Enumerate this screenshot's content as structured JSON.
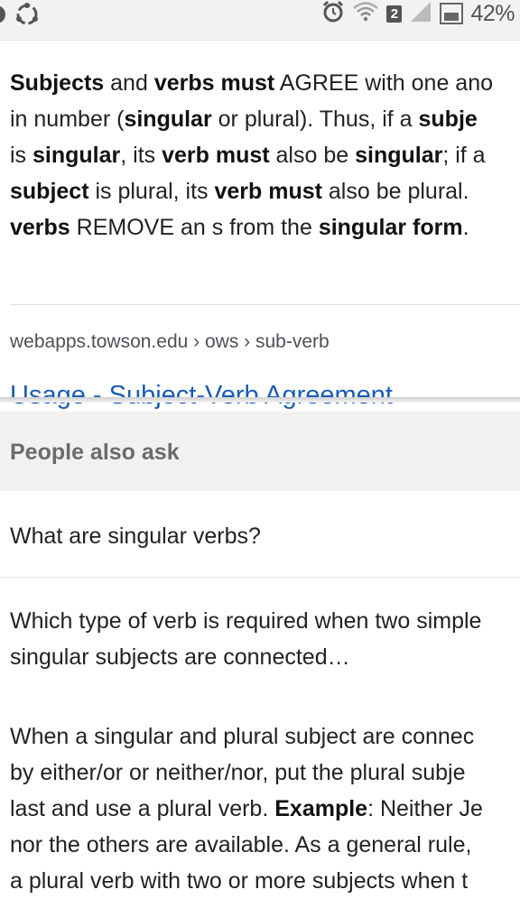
{
  "status_bar": {
    "notification_badge": "2",
    "battery_percent": "42%",
    "icons": [
      "notification-icon",
      "sync-icon",
      "alarm-icon",
      "wifi-icon",
      "signal-icon",
      "battery-icon"
    ]
  },
  "snippet": {
    "lines": [
      [
        {
          "t": "Subjects",
          "b": true
        },
        {
          "t": " and ",
          "b": false
        },
        {
          "t": "verbs must",
          "b": true
        },
        {
          "t": " AGREE with one ano",
          "b": false
        }
      ],
      [
        {
          "t": "in number (",
          "b": false
        },
        {
          "t": "singular",
          "b": true
        },
        {
          "t": " or plural). Thus, if a ",
          "b": false
        },
        {
          "t": "subje",
          "b": true
        }
      ],
      [
        {
          "t": "is ",
          "b": false
        },
        {
          "t": "singular",
          "b": true
        },
        {
          "t": ", its ",
          "b": false
        },
        {
          "t": "verb must",
          "b": true
        },
        {
          "t": " also be ",
          "b": false
        },
        {
          "t": "singular",
          "b": true
        },
        {
          "t": "; if a",
          "b": false
        }
      ],
      [
        {
          "t": "subject",
          "b": true
        },
        {
          "t": " is plural, its ",
          "b": false
        },
        {
          "t": "verb must",
          "b": true
        },
        {
          "t": " also be plural.",
          "b": false
        }
      ],
      [
        {
          "t": "verbs",
          "b": true
        },
        {
          "t": " REMOVE an s from the ",
          "b": false
        },
        {
          "t": "singular form",
          "b": true
        },
        {
          "t": ".",
          "b": false
        }
      ]
    ],
    "source": "webapps.towson.edu › ows › sub-verb",
    "link_title": "Usage - Subject-Verb Agreement"
  },
  "people_also_ask": {
    "title": "People also ask",
    "questions": [
      "What are singular verbs?",
      "Which type of verb is required when two simple singular subjects are connected…"
    ]
  },
  "answer": {
    "lines": [
      [
        {
          "t": "When a singular and plural subject are connec",
          "b": false
        }
      ],
      [
        {
          "t": "by either/or or neither/nor, put the plural subje",
          "b": false
        }
      ],
      [
        {
          "t": "last and use a plural verb. ",
          "b": false
        },
        {
          "t": "Example",
          "b": true
        },
        {
          "t": ": Neither Je",
          "b": false
        }
      ],
      [
        {
          "t": "nor the others are available. As a general rule,",
          "b": false
        }
      ],
      [
        {
          "t": "a plural verb with two or more subjects when t",
          "b": false
        }
      ]
    ]
  },
  "colors": {
    "link": "#1a5db3",
    "paa_background": "#f1f1f1",
    "status_bar": "#f2f2f2"
  }
}
